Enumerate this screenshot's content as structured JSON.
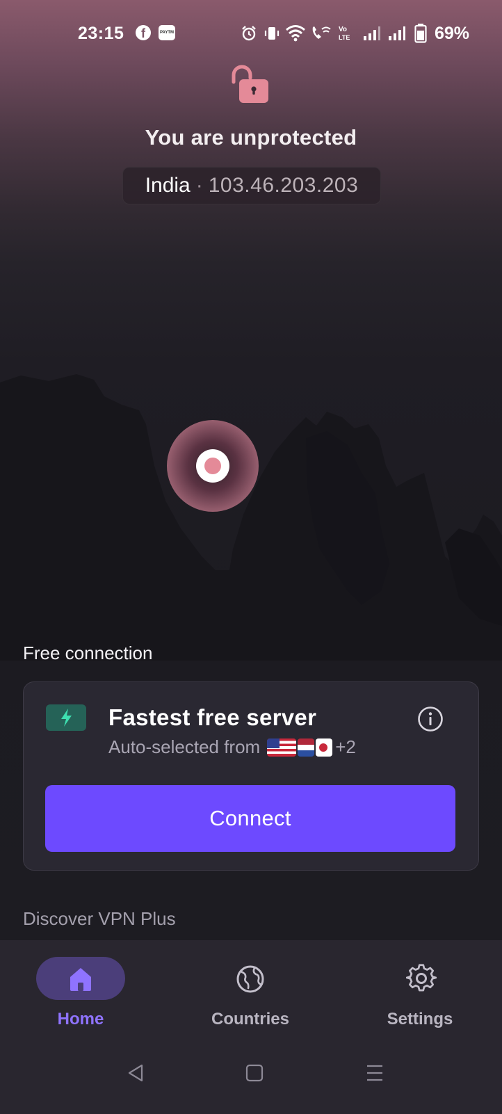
{
  "status_bar": {
    "time": "23:15",
    "battery_percent": "69%",
    "icons": [
      "facebook-icon",
      "paytm-icon",
      "alarm-icon",
      "vibrate-icon",
      "wifi-icon",
      "wifi-calling-icon",
      "volte-icon",
      "signal-icon",
      "signal-icon",
      "battery-icon"
    ]
  },
  "header": {
    "lock_icon": "unlocked-padlock-icon",
    "status_title": "You are unprotected",
    "country": "India",
    "separator": "·",
    "ip_address": "103.46.203.203"
  },
  "map": {
    "marker": "location-marker"
  },
  "free_connection": {
    "section_label": "Free connection",
    "server_title": "Fastest free server",
    "server_subtitle": "Auto-selected from",
    "flags": [
      "us-flag",
      "netherlands-flag",
      "japan-flag"
    ],
    "more_count": "+2",
    "info_icon": "info-icon",
    "connect_label": "Connect"
  },
  "discover": {
    "label": "Discover VPN Plus"
  },
  "bottom_nav": {
    "items": [
      {
        "label": "Home",
        "icon": "home-icon",
        "active": true
      },
      {
        "label": "Countries",
        "icon": "globe-icon",
        "active": false
      },
      {
        "label": "Settings",
        "icon": "gear-icon",
        "active": false
      }
    ]
  },
  "colors": {
    "accent": "#6d4aff",
    "active_nav": "#8f73ff",
    "unprotected": "#e48a98",
    "bolt_badge": "#256257",
    "bolt": "#3ee0b0"
  }
}
